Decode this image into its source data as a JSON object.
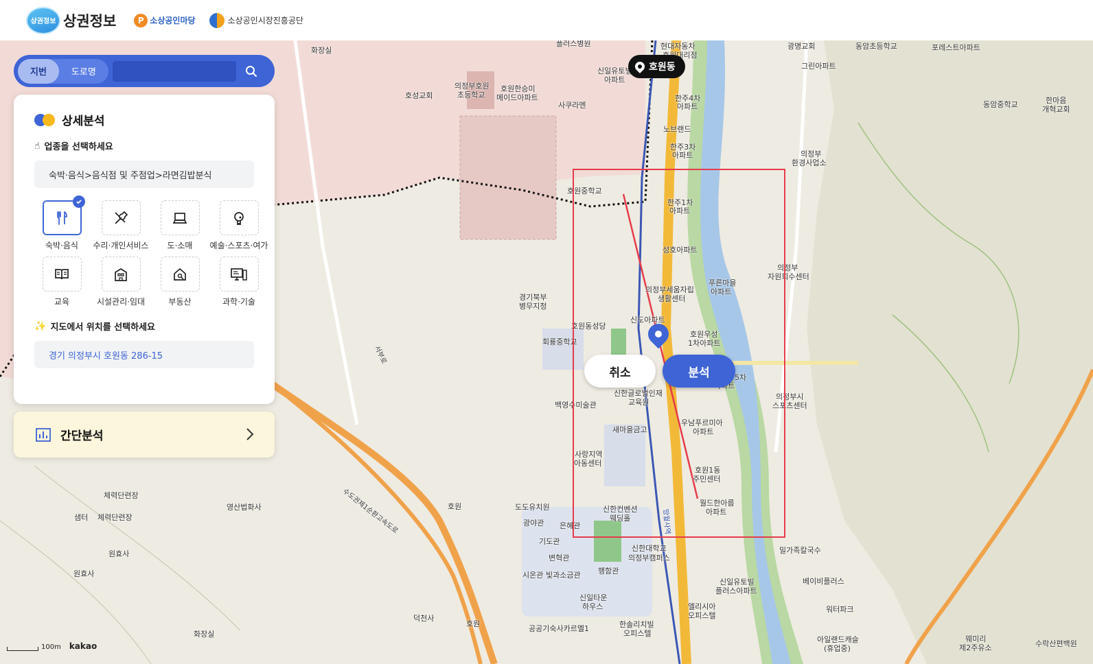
{
  "header": {
    "logo_badge": "상권정보",
    "logo_text": "상권정보",
    "brand2": "소상공인마당",
    "brand3": "소상공인시장진흥공단"
  },
  "search": {
    "tab_jibun": "지번",
    "tab_road": "도로명",
    "input_value": "",
    "icon": "search-icon"
  },
  "panel": {
    "title": "상세분석",
    "select_industry": "업종을 선택하세요",
    "industry_value": "숙박·음식>음식점 및 주점업>라면김밥분식",
    "categories": [
      {
        "label": "숙박·음식",
        "icon": "fork-knife-icon",
        "selected": true
      },
      {
        "label": "수리·개인서비스",
        "icon": "tools-icon",
        "selected": false
      },
      {
        "label": "도·소매",
        "icon": "laptop-icon",
        "selected": false
      },
      {
        "label": "예술·스포츠·여가",
        "icon": "trophy-icon",
        "selected": false
      },
      {
        "label": "교육",
        "icon": "book-icon",
        "selected": false
      },
      {
        "label": "시설관리·임대",
        "icon": "building-icon",
        "selected": false
      },
      {
        "label": "부동산",
        "icon": "house-search-icon",
        "selected": false
      },
      {
        "label": "과학·기술",
        "icon": "monitor-icon",
        "selected": false
      }
    ],
    "select_location": "지도에서 위치를 선택하세요",
    "location_value": "경기 의정부시 호원동 286-15"
  },
  "simple": {
    "title": "간단분석"
  },
  "map": {
    "area_label": "호원동",
    "cancel_label": "취소",
    "analyze_label": "분석",
    "scale_label": "100m",
    "provider": "kakao",
    "labels": {
      "l1": "화장실",
      "l2": "플러스병원",
      "l3": "현대자동차",
      "l4": "호원대리점",
      "l5": "광명교회",
      "l6": "동암초등학교",
      "l7": "포레스트아파트",
      "l8": "그린아파트",
      "l9": "신일유토빌",
      "l10": "아파트",
      "l11": "의정부호원",
      "l12": "초등학교",
      "l13": "호원한승미",
      "l14": "메이드아파트",
      "l15": "호성교회",
      "l16": "사쿠라멘",
      "l17": "한주4차",
      "l18": "아파트",
      "l19": "동암중학교",
      "l20": "한마음",
      "l21": "개혁교회",
      "l22": "노브랜드",
      "l23": "한주3차",
      "l24": "아파트",
      "l25": "의정부",
      "l26": "환경사업소",
      "l27": "호원중학교",
      "l28": "한주1차",
      "l29": "아파트",
      "l30": "성호아파트",
      "l31": "의정부",
      "l32": "자원회수센터",
      "l33": "의정부세움자립",
      "l34": "생활센터",
      "l35": "푸른마을",
      "l36": "아파트",
      "l37": "경기북부",
      "l38": "병무지청",
      "l39": "호원동성당",
      "l40": "신도아파트",
      "l41": "호원우성",
      "l42": "1차아파트",
      "l43": "회룡중학교",
      "l44": "5차",
      "l45": "아파트",
      "l46": "신한글로벌인재",
      "l47": "교육원",
      "l48": "백영수미술관",
      "l49": "의정부시",
      "l50": "스포츠센터",
      "l51": "우남푸르미아",
      "l52": "아파트",
      "l53": "새마을금고",
      "l54": "사랑지역",
      "l55": "아동센터",
      "l56": "호원1동",
      "l57": "주민센터",
      "l58": "체력단련장",
      "l59": "영산법화사",
      "l60": "샘터",
      "l61": "체력단련장",
      "l62": "호원",
      "l63": "도도유치원",
      "l64": "신한컨벤션",
      "l65": "웨딩홀",
      "l66": "월드한아름",
      "l67": "아파트",
      "l68": "광야관",
      "l69": "은혜관",
      "l70": "원효사",
      "l71": "원효사",
      "l72": "기도관",
      "l73": "변혁관",
      "l74": "신한대학교",
      "l75": "의정부캠퍼스",
      "l76": "밀가족칼국수",
      "l77": "행함관",
      "l78": "시온관",
      "l79": "빛과소금관",
      "l80": "베이비플러스",
      "l81": "신일유토빌",
      "l82": "플러스아파트",
      "l83": "신일타운",
      "l84": "하우스",
      "l85": "엘리시아",
      "l86": "오피스텔",
      "l87": "워터파크",
      "l88": "덕천사",
      "l89": "호원",
      "l90": "한솔리치빌",
      "l91": "오피스텔",
      "l92": "공공기숙사카르멜1",
      "l93": "화장실",
      "l94": "아일랜드캐슬",
      "l95": "(휴업중)",
      "l96": "웨미리",
      "l97": "제2주유소",
      "l98": "수락산편백원",
      "l99": "수도권제1순환고속도로",
      "l100": "서부로",
      "l101": "망월사역"
    }
  },
  "colors": {
    "accent": "#3e64d6",
    "yellow": "#f6b81c",
    "selection": "#e63b4a",
    "simple_bg": "#fbf6dc"
  }
}
